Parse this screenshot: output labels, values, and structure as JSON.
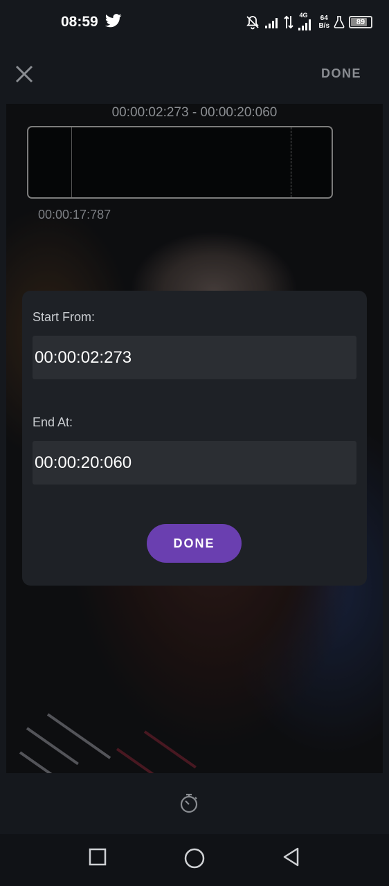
{
  "status_bar": {
    "time": "08:59",
    "network_type": "4G",
    "speed_value": "64",
    "speed_unit": "B/s",
    "battery": "89",
    "battery_level": 0.89,
    "icons": [
      "twitter-icon",
      "notifications-off-icon",
      "signal-icon",
      "data-transfer-icon",
      "signal-4g-icon",
      "lab-icon",
      "battery-icon"
    ]
  },
  "top_bar": {
    "done_label": "DONE",
    "close_icon": "close-icon"
  },
  "trim": {
    "range_label": "00:00:02:273 - 00:00:20:060",
    "cursor_time": "00:00:17:787"
  },
  "dialog": {
    "start_label": "Start From:",
    "start_value": "00:00:02:273",
    "end_label": "End At:",
    "end_value": "00:00:20:060",
    "done_label": "DONE"
  },
  "bottom": {
    "tool_icon": "timer-icon"
  },
  "nav": {
    "icons": [
      "recents-icon",
      "home-icon",
      "back-icon"
    ]
  },
  "colors": {
    "accent": "#6a3fb0",
    "background": "#15181d",
    "dialog": "#1e2126",
    "field": "#2b2e33"
  }
}
